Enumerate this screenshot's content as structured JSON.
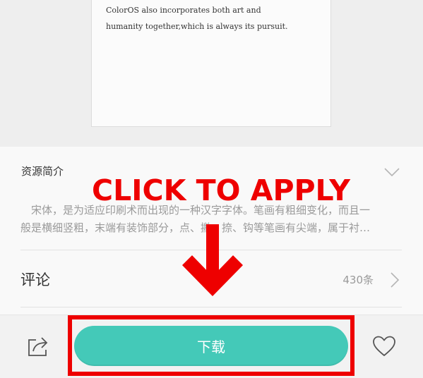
{
  "preview": {
    "line1": "ColorOS also incorporates both art and",
    "line2": "humanity together,which is always its pursuit."
  },
  "intro": {
    "title": "资源简介",
    "line1": "宋体，是为适应印刷术而出现的一种汉字字体。笔画有粗细变化，而且一",
    "line2": "般是横细竖粗，末端有装饰部分，点、撇、捺、钩等笔画有尖端，属于衬…"
  },
  "comments": {
    "label": "评论",
    "count": "430条"
  },
  "bottom_bar": {
    "download_label": "下载"
  },
  "overlay": {
    "caption": "CLICK TO APPLY",
    "color": "#ee0000"
  },
  "colors": {
    "accent": "#44c9b8",
    "highlight": "#ee0000"
  },
  "icons": [
    "chevron-down-icon",
    "chevron-right-icon",
    "share-icon",
    "heart-icon",
    "arrow-down-icon"
  ]
}
